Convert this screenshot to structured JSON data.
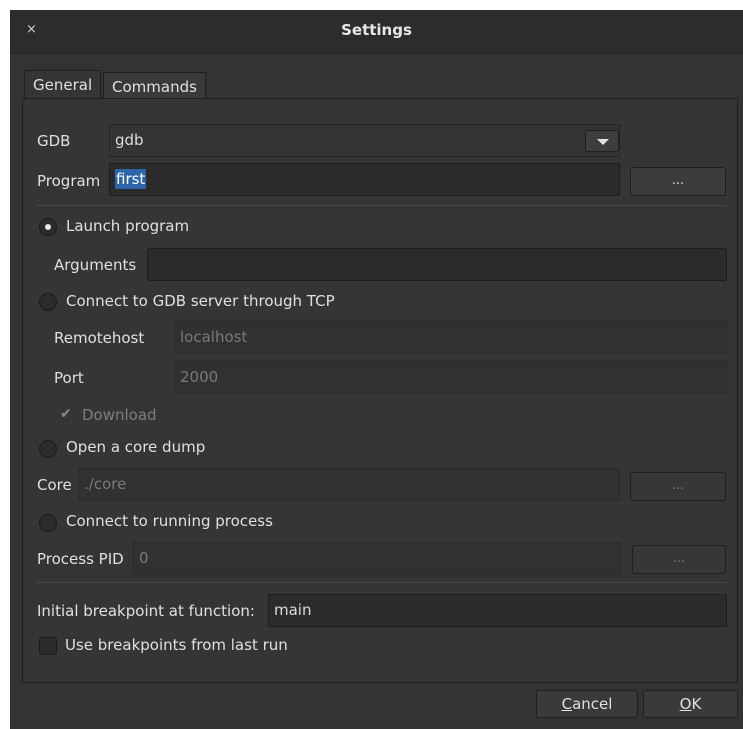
{
  "window": {
    "title": "Settings",
    "close_glyph": "×"
  },
  "tabs": [
    {
      "label": "General",
      "active": true
    },
    {
      "label": "Commands",
      "active": false
    }
  ],
  "general": {
    "gdb_label": "GDB",
    "gdb_value": "gdb",
    "program_label": "Program",
    "program_value": "first",
    "browse_label": "...",
    "launch_program_label": "Launch program",
    "arguments_label": "Arguments",
    "arguments_value": "",
    "connect_tcp_label": "Connect to GDB server through TCP",
    "remotehost_label": "Remotehost",
    "remotehost_value": "localhost",
    "port_label": "Port",
    "port_value": "2000",
    "download_label": "Download",
    "download_checked": true,
    "core_dump_label": "Open a core dump",
    "core_label": "Core",
    "core_value": "./core",
    "connect_process_label": "Connect to running process",
    "process_pid_label": "Process PID",
    "process_pid_value": "0",
    "initial_bp_label": "Initial breakpoint at function:",
    "initial_bp_value": "main",
    "use_last_bp_label": "Use breakpoints from last run",
    "use_last_bp_checked": false,
    "selected_mode": "Launch program"
  },
  "footer": {
    "cancel_mnemonic": "C",
    "cancel_rest": "ancel",
    "ok_mnemonic": "O",
    "ok_rest": "K"
  },
  "colors": {
    "window_bg": "#333333",
    "titlebar_bg": "#2c2c2c",
    "selection": "#2e65a8",
    "text": "#dcdcdc",
    "disabled_text": "#7a7a7a"
  }
}
